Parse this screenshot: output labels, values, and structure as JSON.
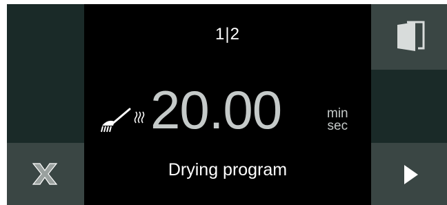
{
  "display": {
    "page_indicator": "1|2",
    "time_value": "20.00",
    "unit_min": "min",
    "unit_sec": "sec",
    "program_label": "Drying program"
  },
  "icons": {
    "cancel": "close-icon",
    "door": "door-icon",
    "start": "play-icon",
    "brush": "brush-icon",
    "heat": "heat-icon"
  },
  "colors": {
    "background": "#000000",
    "panel_dark": "#1a2a28",
    "panel_button": "#3a4644",
    "timer_text": "#c5cac9",
    "label_text": "#ffffff"
  }
}
